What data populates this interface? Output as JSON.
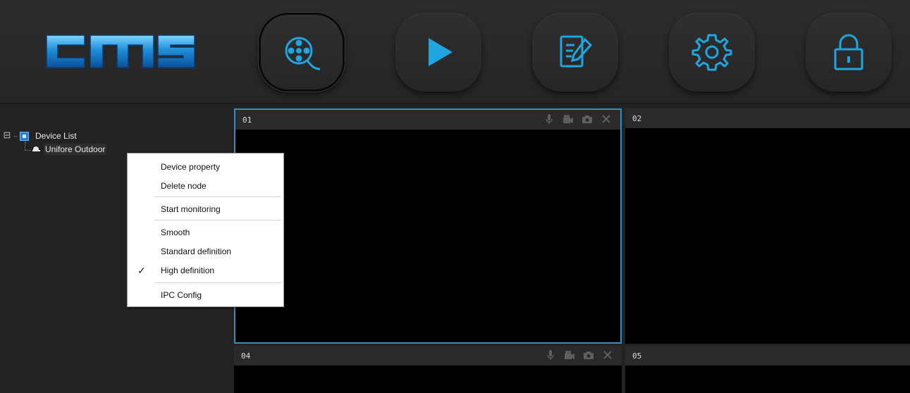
{
  "app": {
    "logo_text": "cms"
  },
  "toolbar": {
    "buttons": [
      {
        "name": "live-view",
        "icon": "film-reel-icon",
        "active": true
      },
      {
        "name": "playback",
        "icon": "play-icon"
      },
      {
        "name": "log",
        "icon": "edit-document-icon"
      },
      {
        "name": "settings",
        "icon": "gear-icon"
      },
      {
        "name": "lock",
        "icon": "lock-icon"
      }
    ],
    "accent_color": "#1fa6e0"
  },
  "device_tree": {
    "root_label": "Device List",
    "expander": "⊟",
    "children": [
      {
        "label": "Unifore Outdoor"
      }
    ]
  },
  "video_panes": [
    {
      "id": "01"
    },
    {
      "id": "02"
    },
    {
      "id": "04"
    },
    {
      "id": "05"
    }
  ],
  "context_menu": {
    "items": [
      {
        "label": "Device property"
      },
      {
        "label": "Delete node"
      },
      {
        "label": "Start monitoring"
      },
      {
        "label": "Smooth"
      },
      {
        "label": "Standard definition"
      },
      {
        "label": "High definition",
        "checked": true
      },
      {
        "label": "IPC Config"
      }
    ],
    "check_mark": "✓"
  },
  "colors": {
    "selected_pane_border": "#2f8fc6",
    "background": "#232323"
  }
}
